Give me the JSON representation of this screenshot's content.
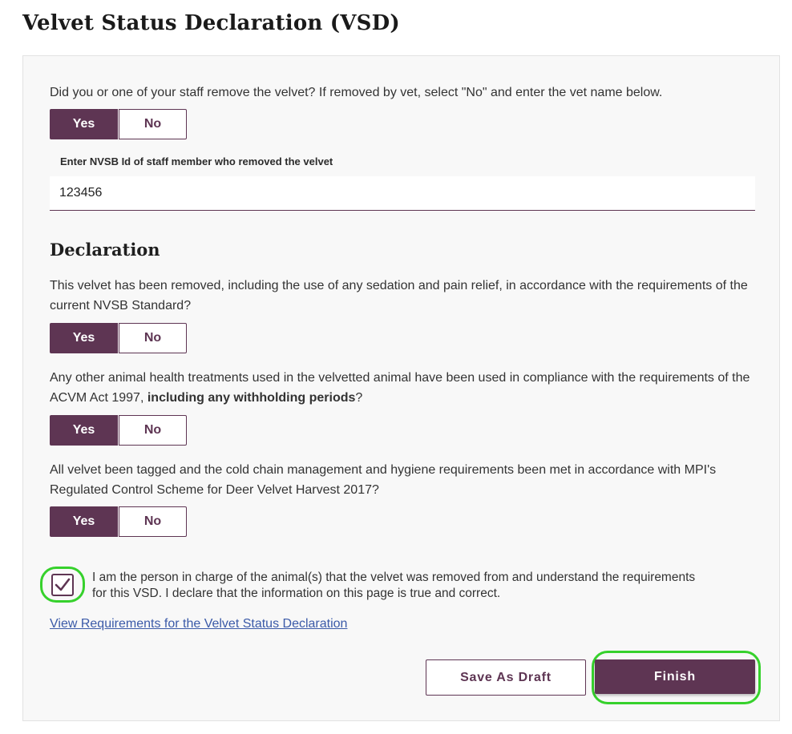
{
  "page": {
    "title": "Velvet Status Declaration (VSD)"
  },
  "removal": {
    "question": "Did you or one of your staff remove the velvet? If removed by vet, select \"No\" and enter the vet name below.",
    "yes_label": "Yes",
    "no_label": "No",
    "selected": "Yes",
    "staff_id_label": "Enter NVSB Id of staff member who removed the velvet",
    "staff_id_value": "123456"
  },
  "declaration": {
    "heading": "Declaration",
    "questions": [
      {
        "text": "This velvet has been removed, including the use of any sedation and pain relief, in accordance with the requirements of the current NVSB Standard?",
        "yes_label": "Yes",
        "no_label": "No",
        "selected": "Yes"
      },
      {
        "text_before": "Any other animal health treatments used in the velvetted animal have been used in compliance with the requirements of the ACVM Act 1997, ",
        "text_bold": "including any withholding periods",
        "text_after": "?",
        "yes_label": "Yes",
        "no_label": "No",
        "selected": "Yes"
      },
      {
        "text": "All velvet been tagged and the cold chain management and hygiene requirements been met in accordance with MPI's Regulated Control Scheme for Deer Velvet Harvest 2017?",
        "yes_label": "Yes",
        "no_label": "No",
        "selected": "Yes"
      }
    ],
    "confirm_checked": true,
    "confirm_text": "I am the person in charge of the animal(s) that the velvet was removed from and understand the requirements for this VSD. I declare that the information on this page is true and correct.",
    "requirements_link": "View Requirements for the Velvet Status Declaration"
  },
  "actions": {
    "save_draft_label": "Save As Draft",
    "finish_label": "Finish"
  },
  "colors": {
    "accent": "#5e3553",
    "highlight": "#36d12c",
    "link": "#3b5aa8"
  },
  "icons": {
    "checkbox": "checkmark-icon"
  }
}
